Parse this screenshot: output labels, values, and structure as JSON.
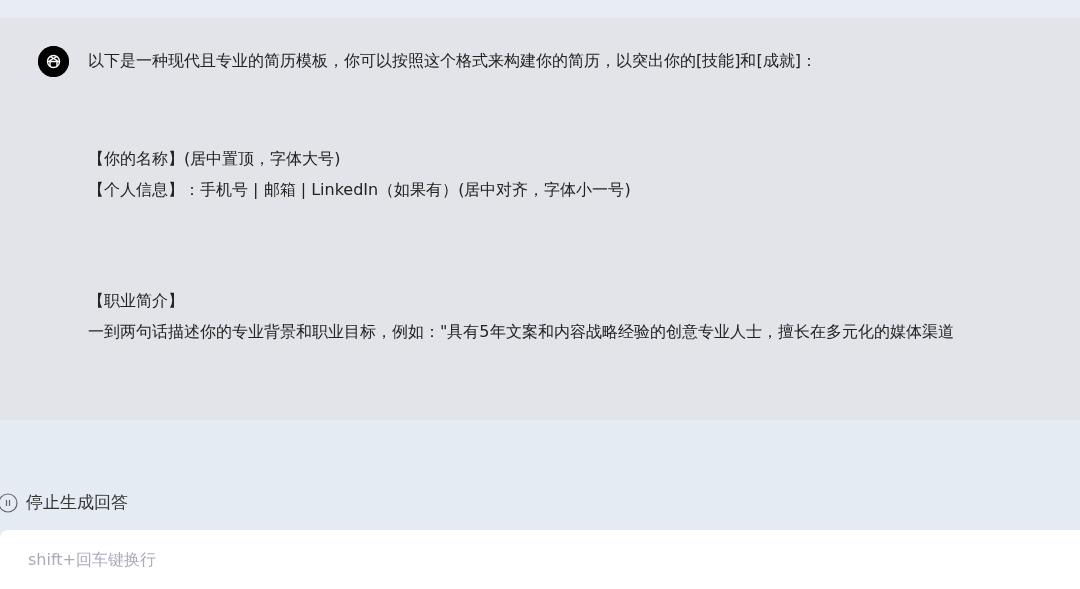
{
  "message": {
    "intro": "以下是一种现代且专业的简历模板，你可以按照这个格式来构建你的简历，以突出你的[技能]和[成就]：",
    "sections": [
      {
        "lines": [
          "【你的名称】(居中置顶，字体大号)",
          "【个人信息】：手机号 | 邮箱 | LinkedIn（如果有）(居中对齐，字体小一号)"
        ]
      },
      {
        "lines": [
          "【职业简介】",
          "一到两句话描述你的专业背景和职业目标，例如：\"具有5年文案和内容战略经验的创意专业人士，擅长在多元化的媒体渠道"
        ]
      }
    ]
  },
  "stop_button": {
    "label": "停止生成回答"
  },
  "input": {
    "placeholder": "shift+回车键换行"
  }
}
